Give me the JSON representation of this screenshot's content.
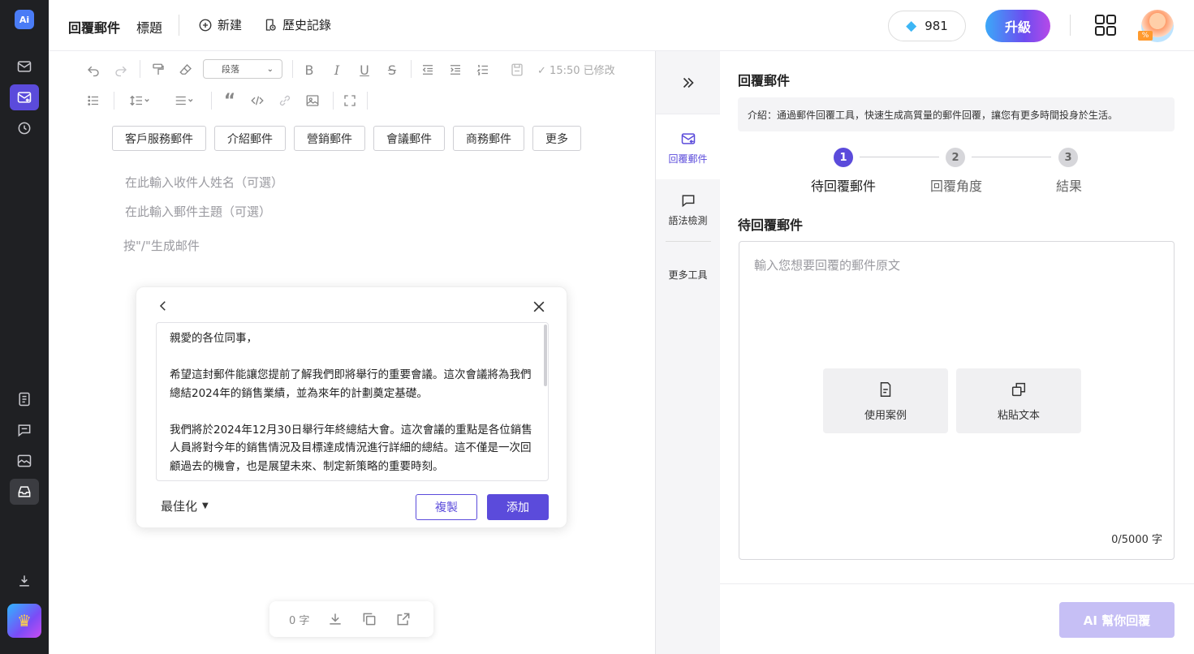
{
  "app": {
    "logo": "Ai"
  },
  "sidebar": {
    "icons": [
      "mail-icon",
      "reply-mail-icon",
      "history-icon",
      "document-icon",
      "chat-icon",
      "image-icon",
      "inbox-icon",
      "download-icon",
      "crown-icon"
    ]
  },
  "header": {
    "title": "回覆郵件",
    "subtitle": "標題",
    "new_label": "新建",
    "history_label": "歷史記錄",
    "credits": "981",
    "upgrade_label": "升級",
    "avatar_badge": "%"
  },
  "toolbar": {
    "paragraph_select": "段落",
    "saved_status": "15:50 已修改"
  },
  "editor": {
    "templates": [
      "客戶服務郵件",
      "介紹郵件",
      "營銷郵件",
      "會議郵件",
      "商務郵件",
      "更多"
    ],
    "recipient_placeholder": "在此輸入收件人姓名（可選）",
    "subject_placeholder": "在此輸入郵件主題（可選）",
    "prompt_hint": "按\"/\"生成邮件"
  },
  "popup": {
    "paragraphs": [
      "親愛的各位同事，",
      "希望這封郵件能讓您提前了解我們即將舉行的重要會議。這次會議將為我們總結2024年的銷售業績，並為來年的計劃奠定基礎。",
      "我們將於2024年12月30日舉行年終總結大會。這次會議的重點是各位銷售人員將對今年的銷售情況及目標達成情況進行詳細的總結。這不僅是一次回顧過去的機會，也是展望未來、制定新策略的重要時刻。"
    ],
    "optimize_label": "最佳化",
    "copy_label": "複製",
    "add_label": "添加"
  },
  "bottom_bar": {
    "word_count": "0 字"
  },
  "tools_column": {
    "reply_label": "回覆郵件",
    "grammar_label": "語法檢測",
    "more_label": "更多工具"
  },
  "panel": {
    "title": "回覆郵件",
    "intro": "介紹：通過郵件回覆工具，快速生成高質量的郵件回覆，讓您有更多時間投身於生活。",
    "steps": [
      {
        "num": "1",
        "label": "待回覆郵件"
      },
      {
        "num": "2",
        "label": "回覆角度"
      },
      {
        "num": "3",
        "label": "結果"
      }
    ],
    "section_title": "待回覆郵件",
    "textarea_placeholder": "輸入您想要回覆的郵件原文",
    "example_label": "使用案例",
    "paste_label": "粘貼文本",
    "char_count": "0/5000 字",
    "ai_button": "AI 幫你回覆"
  },
  "colors": {
    "accent": "#5b4bdb",
    "rail_bg": "#1f2023",
    "ai_button_disabled": "#c6bff5"
  }
}
